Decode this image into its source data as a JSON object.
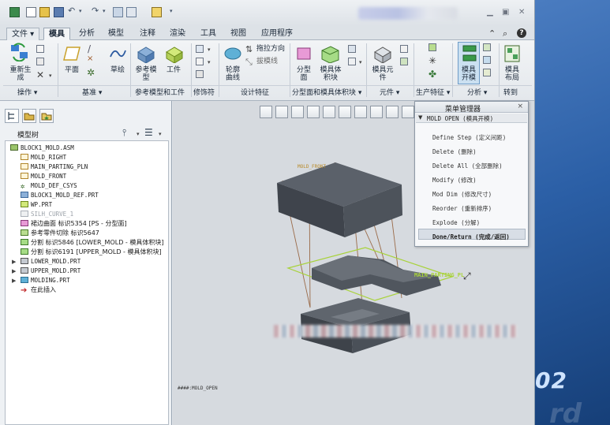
{
  "tabs": {
    "file": "文件",
    "mold": "模具",
    "analysis": "分析",
    "model": "模型",
    "annotate": "注释",
    "render": "渲染",
    "tools": "工具",
    "view": "视图",
    "apps": "应用程序"
  },
  "ribbon": {
    "regenerate": "重新生\n成",
    "plane": "平面",
    "sketch": "草绘",
    "ref_model": "参考模\n型",
    "workpiece": "工件",
    "draft_dir": "拖拉方向",
    "draft_line": "拔模线",
    "outline_curve": "轮廓\n曲线",
    "parting_surface": "分型\n面",
    "mold_volume": "模具体\n积块",
    "mold_component": "模具元\n件",
    "mold_open": "模具\n开模",
    "mold_layout": "模具\n布局",
    "groups": {
      "operations": "操作",
      "datum": "基准",
      "ref_model_workpiece": "参考模型和工件",
      "modifiers": "修饰符",
      "design_features": "设计特征",
      "parting_volume": "分型面和模具体积块",
      "components": "元件",
      "production": "生产特征",
      "analysis": "分析",
      "goto": "转到"
    }
  },
  "model_tree": {
    "title": "模型树",
    "items": [
      "BLOCK1_MOLD.ASM",
      "MOLD_RIGHT",
      "MAIN_PARTING_PLN",
      "MOLD_FRONT",
      "MOLD_DEF_CSYS",
      "BLOCK1_MOLD_REF.PRT",
      "WP.PRT",
      "SILH_CURVE_1",
      "裙边曲面 标识5354 [PS - 分型面]",
      "参考零件切除 标识5647",
      "分割 标识5846 [LOWER_MOLD - 模具体积块]",
      "分割 标识6191 [UPPER_MOLD - 模具体积块]",
      "LOWER_MOLD.PRT",
      "UPPER_MOLD.PRT",
      "MOLDING.PRT",
      "在此插入"
    ]
  },
  "menu_manager": {
    "title": "菜单管理器",
    "subtitle": "MOLD OPEN (模具开模)",
    "items": [
      "Define Step (定义间距)",
      "Delete (删除)",
      "Delete All (全部删除)",
      "Modify (修改)",
      "Mod Dim (修改尺寸)",
      "Reorder (重新排序)",
      "Explode (分解)",
      "Done/Return (完成/返回)"
    ]
  },
  "graphics": {
    "mold_front_label": "MOLD_FRONT",
    "parting_plane_label": "MAIN_PARTING_PL",
    "assembly_name": "####:MOLD_OPEN"
  },
  "desktop": {
    "number": "02",
    "ghost": "rd"
  },
  "colors": {
    "accent": "#3b8a4c",
    "parting_plane": "#a8d23a",
    "mold_body": "#4a4f57",
    "draft_line": "#8a5a3a"
  }
}
